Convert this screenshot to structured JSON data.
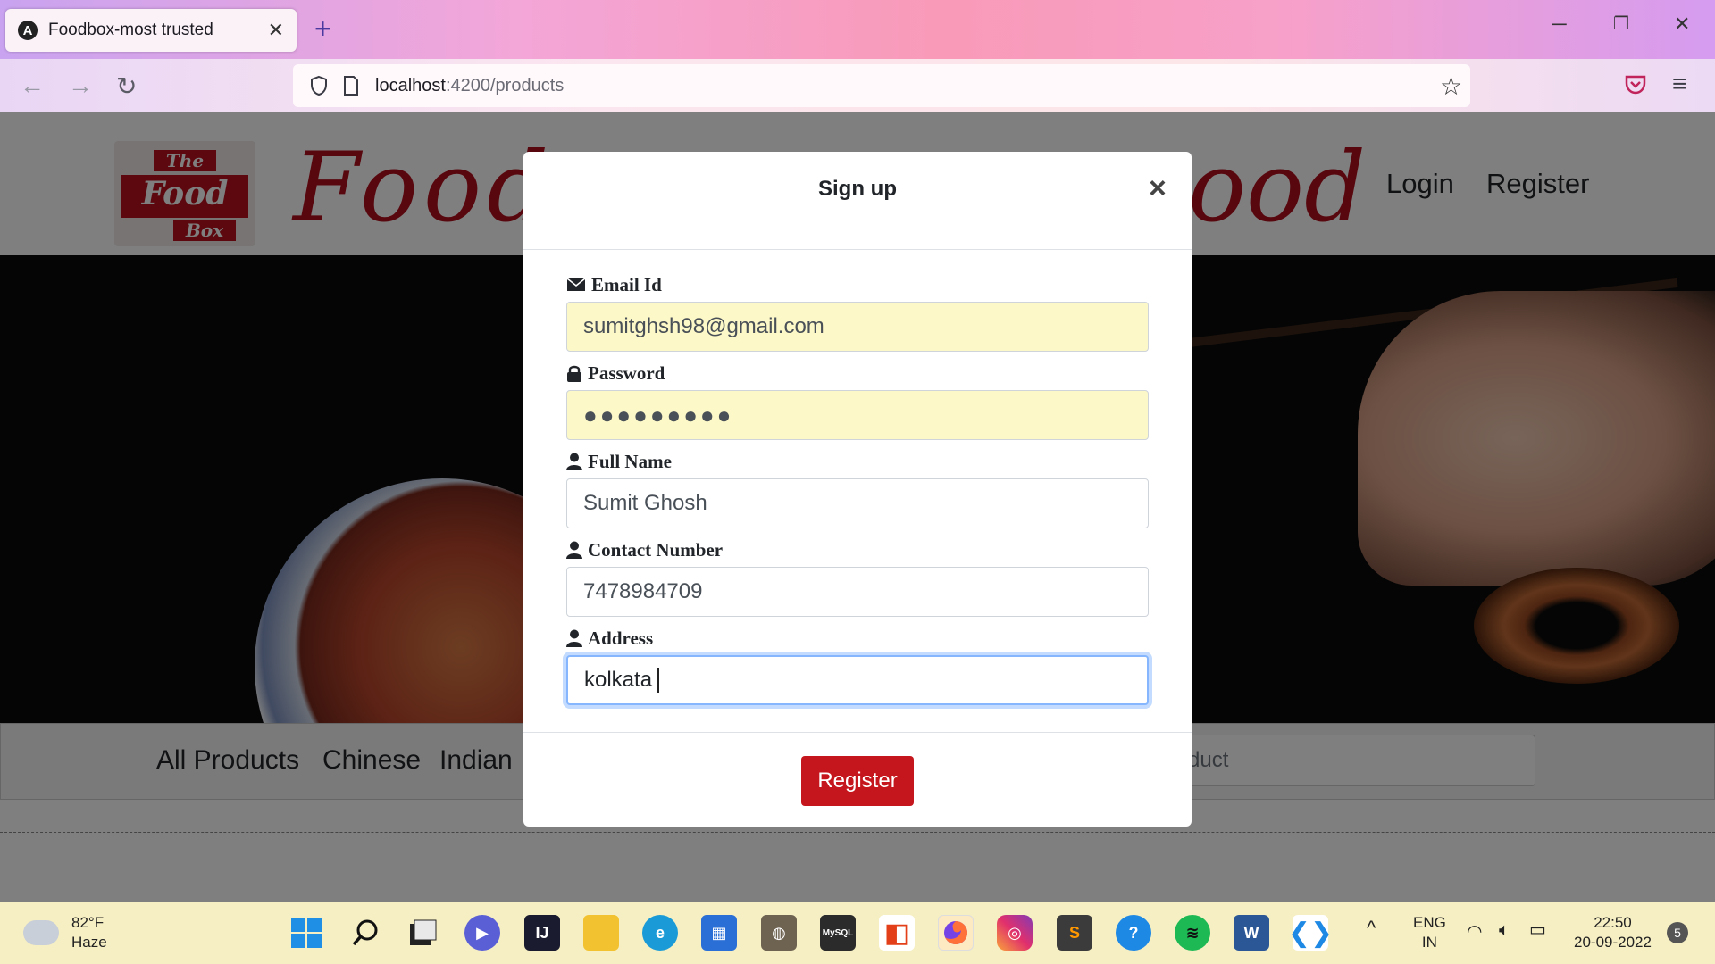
{
  "browser": {
    "tab_title": "Foodbox-most trusted",
    "tab_close": "✕",
    "new_tab": "+",
    "url_host": "localhost",
    "url_rest": ":4200/products"
  },
  "site": {
    "logo_line1": "The",
    "logo_line2": "Food",
    "logo_line3": "Box",
    "brand_left": "Food",
    "brand_right": "ood",
    "nav_login": "Login",
    "nav_register": "Register",
    "categories": [
      "All Products",
      "Chinese",
      "Indian"
    ],
    "search_placeholder": "duct"
  },
  "modal": {
    "title": "Sign up",
    "close": "×",
    "fields": [
      {
        "label": "Email Id",
        "value": "sumitghsh98@gmail.com",
        "icon": "envelope-icon"
      },
      {
        "label": "Password",
        "value": "●●●●●●●●●",
        "icon": "lock-icon"
      },
      {
        "label": "Full Name",
        "value": "Sumit Ghosh",
        "icon": "user-icon"
      },
      {
        "label": "Contact Number",
        "value": "7478984709",
        "icon": "user-icon"
      },
      {
        "label": "Address",
        "value": "kolkata",
        "icon": "user-icon"
      }
    ],
    "submit_label": "Register"
  },
  "taskbar": {
    "temperature": "82°F",
    "weather": "Haze",
    "lang_line1": "ENG",
    "lang_line2": "IN",
    "time": "22:50",
    "date": "20-09-2022",
    "notifications": "5"
  },
  "colors": {
    "brand_red": "#b10f1c",
    "button_red": "#c4161c",
    "autofill_yellow": "#fdf8c8",
    "focus_blue": "#86b7fe"
  }
}
